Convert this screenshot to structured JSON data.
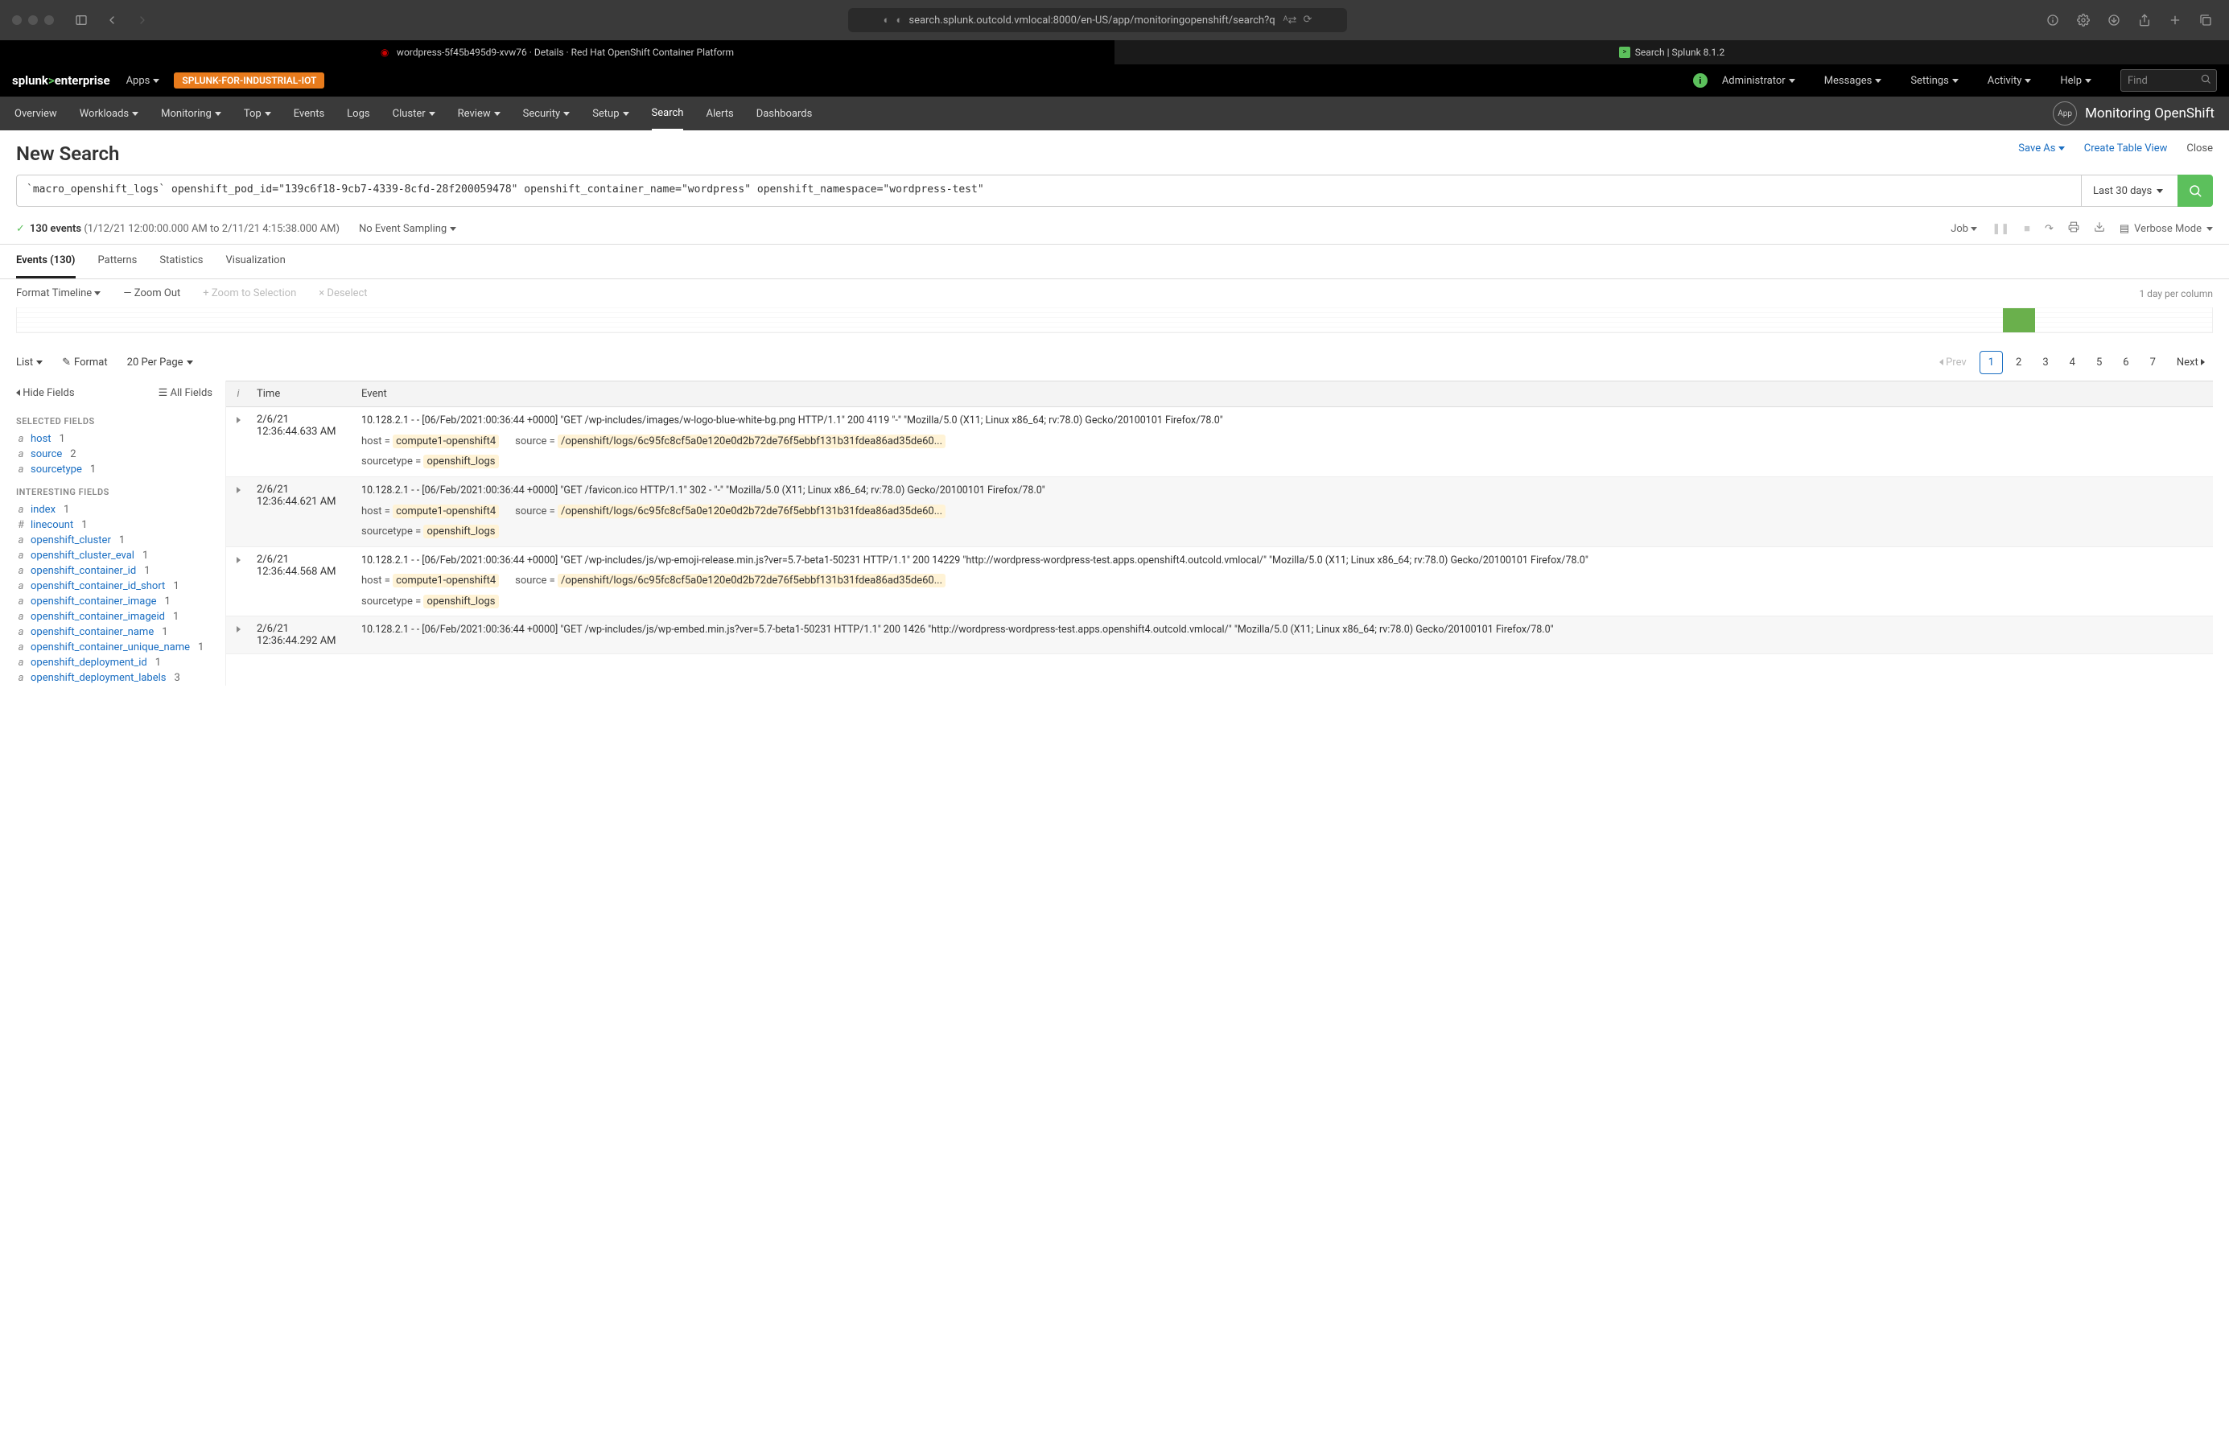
{
  "browser": {
    "url": "search.splunk.outcold.vmlocal:8000/en-US/app/monitoringopenshift/search?q",
    "tabs": [
      {
        "icon_color": "#cc0000",
        "label": "wordpress-5f45b495d9-xvw76 · Details · Red Hat OpenShift Container Platform"
      },
      {
        "icon_color": "#5cc05c",
        "label": "Search | Splunk 8.1.2"
      }
    ]
  },
  "splunk_bar": {
    "logo": "splunk>enterprise",
    "apps": "Apps",
    "pill": "SPLUNK-FOR-INDUSTRIAL-IOT",
    "admin": "Administrator",
    "messages": "Messages",
    "settings": "Settings",
    "activity": "Activity",
    "help": "Help",
    "find_placeholder": "Find"
  },
  "app_nav": {
    "items": [
      "Overview",
      "Workloads",
      "Monitoring",
      "Top",
      "Events",
      "Logs",
      "Cluster",
      "Review",
      "Security",
      "Setup",
      "Search",
      "Alerts",
      "Dashboards"
    ],
    "active": "Search",
    "app_title": "Monitoring OpenShift",
    "app_icon": "App"
  },
  "page": {
    "title": "New Search",
    "actions": {
      "save_as": "Save As",
      "create_table": "Create Table View",
      "close": "Close"
    }
  },
  "search": {
    "query": "`macro_openshift_logs` openshift_pod_id=\"139c6f18-9cb7-4339-8cfd-28f200059478\" openshift_container_name=\"wordpress\" openshift_namespace=\"wordpress-test\"",
    "time_picker": "Last 30 days"
  },
  "status": {
    "event_count": "130 events",
    "range": "(1/12/21 12:00:00.000 AM to 2/11/21 4:15:38.000 AM)",
    "sampling": "No Event Sampling",
    "job": "Job",
    "verbose": "Verbose Mode"
  },
  "result_tabs": [
    "Events (130)",
    "Patterns",
    "Statistics",
    "Visualization"
  ],
  "timeline": {
    "format": "Format Timeline",
    "zoom_out": "Zoom Out",
    "zoom_sel": "Zoom to Selection",
    "deselect": "Deselect",
    "column_label": "1 day per column"
  },
  "list_controls": {
    "list": "List",
    "format": "Format",
    "per_page": "20 Per Page"
  },
  "pagination": {
    "prev": "Prev",
    "pages": [
      "1",
      "2",
      "3",
      "4",
      "5",
      "6",
      "7"
    ],
    "next": "Next",
    "active": "1"
  },
  "fields": {
    "hide": "Hide Fields",
    "all": "All Fields",
    "selected_label": "SELECTED FIELDS",
    "selected": [
      {
        "t": "a",
        "name": "host",
        "count": "1"
      },
      {
        "t": "a",
        "name": "source",
        "count": "2"
      },
      {
        "t": "a",
        "name": "sourcetype",
        "count": "1"
      }
    ],
    "interesting_label": "INTERESTING FIELDS",
    "interesting": [
      {
        "t": "a",
        "name": "index",
        "count": "1"
      },
      {
        "t": "#",
        "name": "linecount",
        "count": "1"
      },
      {
        "t": "a",
        "name": "openshift_cluster",
        "count": "1"
      },
      {
        "t": "a",
        "name": "openshift_cluster_eval",
        "count": "1"
      },
      {
        "t": "a",
        "name": "openshift_container_id",
        "count": "1"
      },
      {
        "t": "a",
        "name": "openshift_container_id_short",
        "count": "1"
      },
      {
        "t": "a",
        "name": "openshift_container_image",
        "count": "1"
      },
      {
        "t": "a",
        "name": "openshift_container_imageid",
        "count": "1"
      },
      {
        "t": "a",
        "name": "openshift_container_name",
        "count": "1"
      },
      {
        "t": "a",
        "name": "openshift_container_unique_name",
        "count": "1"
      },
      {
        "t": "a",
        "name": "openshift_deployment_id",
        "count": "1"
      },
      {
        "t": "a",
        "name": "openshift_deployment_labels",
        "count": "3"
      }
    ]
  },
  "events_header": {
    "i": "i",
    "time": "Time",
    "event": "Event"
  },
  "events": [
    {
      "alt": false,
      "date": "2/6/21",
      "time": "12:36:44.633 AM",
      "raw": "10.128.2.1 - - [06/Feb/2021:00:36:44 +0000] \"GET /wp-includes/images/w-logo-blue-white-bg.png HTTP/1.1\" 200 4119 \"-\" \"Mozilla/5.0 (X11; Linux x86_64; rv:78.0) Gecko/20100101 Firefox/78.0\"",
      "host": "compute1-openshift4",
      "source": "/openshift/logs/6c95fc8cf5a0e120e0d2b72de76f5ebbf131b31fdea86ad35de60...",
      "sourcetype": "openshift_logs"
    },
    {
      "alt": true,
      "date": "2/6/21",
      "time": "12:36:44.621 AM",
      "raw": "10.128.2.1 - - [06/Feb/2021:00:36:44 +0000] \"GET /favicon.ico HTTP/1.1\" 302 - \"-\" \"Mozilla/5.0 (X11; Linux x86_64; rv:78.0) Gecko/20100101 Firefox/78.0\"",
      "host": "compute1-openshift4",
      "source": "/openshift/logs/6c95fc8cf5a0e120e0d2b72de76f5ebbf131b31fdea86ad35de60...",
      "sourcetype": "openshift_logs"
    },
    {
      "alt": false,
      "date": "2/6/21",
      "time": "12:36:44.568 AM",
      "raw": "10.128.2.1 - - [06/Feb/2021:00:36:44 +0000] \"GET /wp-includes/js/wp-emoji-release.min.js?ver=5.7-beta1-50231 HTTP/1.1\" 200 14229 \"http://wordpress-wordpress-test.apps.openshift4.outcold.vmlocal/\" \"Mozilla/5.0 (X11; Linux x86_64; rv:78.0) Gecko/20100101 Firefox/78.0\"",
      "host": "compute1-openshift4",
      "source": "/openshift/logs/6c95fc8cf5a0e120e0d2b72de76f5ebbf131b31fdea86ad35de60...",
      "sourcetype": "openshift_logs"
    },
    {
      "alt": true,
      "date": "2/6/21",
      "time": "12:36:44.292 AM",
      "raw": "10.128.2.1 - - [06/Feb/2021:00:36:44 +0000] \"GET /wp-includes/js/wp-embed.min.js?ver=5.7-beta1-50231 HTTP/1.1\" 200 1426 \"http://wordpress-wordpress-test.apps.openshift4.outcold.vmlocal/\" \"Mozilla/5.0 (X11; Linux x86_64; rv:78.0) Gecko/20100101 Firefox/78.0\"",
      "host": "",
      "source": "",
      "sourcetype": ""
    }
  ],
  "meta_labels": {
    "host": "host =",
    "source": "source =",
    "sourcetype": "sourcetype ="
  }
}
